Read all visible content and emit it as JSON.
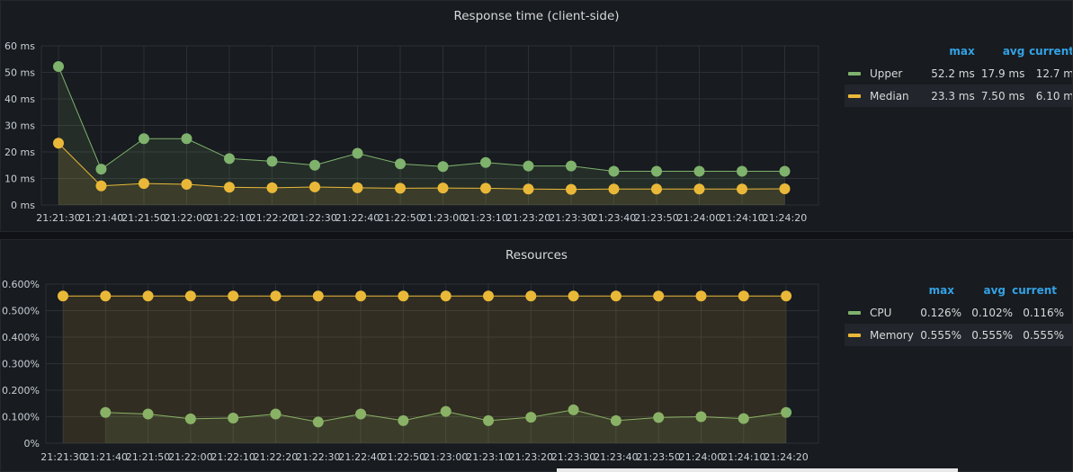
{
  "panels": [
    {
      "title": "Response time (client-side)",
      "legend": {
        "headers": {
          "max": "max",
          "avg": "avg",
          "current": "current"
        },
        "rows": [
          {
            "name": "Upper",
            "color": "#7eb26d",
            "max": "52.2 ms",
            "avg": "17.9 ms",
            "current": "12.7 m"
          },
          {
            "name": "Median",
            "color": "#eab839",
            "max": "23.3 ms",
            "avg": "7.50 ms",
            "current": "6.10 m"
          }
        ]
      }
    },
    {
      "title": "Resources",
      "legend": {
        "headers": {
          "max": "max",
          "avg": "avg",
          "current": "current"
        },
        "rows": [
          {
            "name": "CPU",
            "color": "#7eb26d",
            "max": "0.126%",
            "avg": "0.102%",
            "current": "0.116%"
          },
          {
            "name": "Memory",
            "color": "#eab839",
            "max": "0.555%",
            "avg": "0.555%",
            "current": "0.555%"
          }
        ]
      }
    }
  ],
  "chart_data": [
    {
      "type": "line",
      "title": "Response time (client-side)",
      "unit": "ms",
      "x": [
        "21:21:30",
        "21:21:40",
        "21:21:50",
        "21:22:00",
        "21:22:10",
        "21:22:20",
        "21:22:30",
        "21:22:40",
        "21:22:50",
        "21:23:00",
        "21:23:10",
        "21:23:20",
        "21:23:30",
        "21:23:40",
        "21:23:50",
        "21:24:00",
        "21:24:10",
        "21:24:20"
      ],
      "ylim": [
        0,
        60
      ],
      "yticks": [
        0,
        10,
        20,
        30,
        40,
        50,
        60
      ],
      "ytick_labels": [
        "0 ms",
        "10 ms",
        "20 ms",
        "30 ms",
        "40 ms",
        "50 ms",
        "60 ms"
      ],
      "grid": true,
      "fill": true,
      "legend_position": "right",
      "series": [
        {
          "name": "Upper",
          "color": "#7eb26d",
          "values": [
            52.2,
            13.5,
            25.0,
            25.0,
            17.5,
            16.5,
            15.0,
            19.5,
            15.5,
            14.5,
            16.0,
            14.7,
            14.7,
            12.7,
            12.7,
            12.7,
            12.7,
            12.7
          ]
        },
        {
          "name": "Median",
          "color": "#eab839",
          "values": [
            23.3,
            7.2,
            8.1,
            7.8,
            6.7,
            6.5,
            6.8,
            6.5,
            6.3,
            6.4,
            6.3,
            6.0,
            5.9,
            6.0,
            6.0,
            6.0,
            6.0,
            6.1
          ]
        }
      ]
    },
    {
      "type": "line",
      "title": "Resources",
      "unit": "%",
      "x": [
        "21:21:30",
        "21:21:40",
        "21:21:50",
        "21:22:00",
        "21:22:10",
        "21:22:20",
        "21:22:30",
        "21:22:40",
        "21:22:50",
        "21:23:00",
        "21:23:10",
        "21:23:20",
        "21:23:30",
        "21:23:40",
        "21:23:50",
        "21:24:00",
        "21:24:10",
        "21:24:20"
      ],
      "ylim": [
        0,
        0.6
      ],
      "yticks": [
        0,
        0.1,
        0.2,
        0.3,
        0.4,
        0.5,
        0.6
      ],
      "ytick_labels": [
        "0%",
        "0.100%",
        "0.200%",
        "0.300%",
        "0.400%",
        "0.500%",
        "0.600%"
      ],
      "grid": true,
      "fill": true,
      "legend_position": "right",
      "series": [
        {
          "name": "CPU",
          "color": "#7eb26d",
          "values": [
            null,
            0.116,
            0.11,
            0.092,
            0.095,
            0.11,
            0.08,
            0.11,
            0.085,
            0.12,
            0.085,
            0.098,
            0.126,
            0.085,
            0.097,
            0.1,
            0.093,
            0.116
          ]
        },
        {
          "name": "Memory",
          "color": "#eab839",
          "values": [
            0.555,
            0.555,
            0.555,
            0.555,
            0.555,
            0.555,
            0.555,
            0.555,
            0.555,
            0.555,
            0.555,
            0.555,
            0.555,
            0.555,
            0.555,
            0.555,
            0.555,
            0.555
          ]
        }
      ]
    }
  ]
}
